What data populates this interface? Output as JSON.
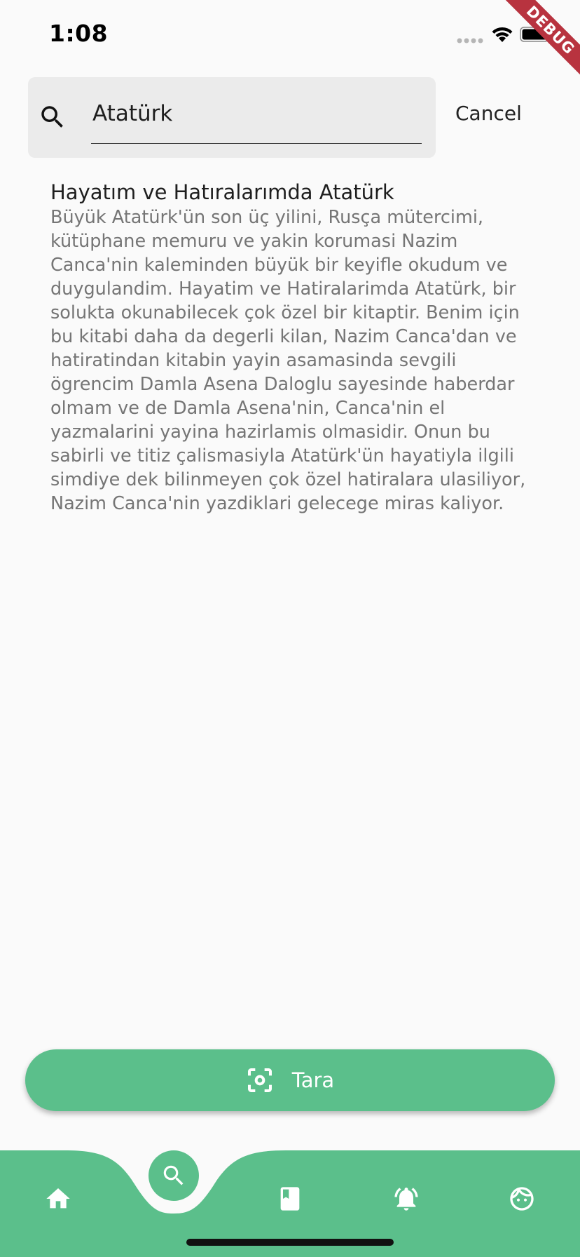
{
  "status_bar": {
    "time": "1:08"
  },
  "debug_banner": {
    "label": "DEBUG"
  },
  "search": {
    "value": "Atatürk",
    "cancel_label": "Cancel"
  },
  "results": [
    {
      "title": "Hayatım ve Hatıralarımda Atatürk",
      "description": "Büyük Atatürk'ün son üç yilini, Rusça mütercimi, kütüphane memuru ve yakin korumasi Nazim Canca'nin kaleminden büyük bir keyifle okudum ve duygulandim. Hayatim ve Hatiralarimda Atatürk, bir solukta okunabilecek çok özel bir kitaptir. Benim için bu kitabi daha da degerli kilan, Nazim Canca'dan ve hatiratindan kitabin yayin asamasinda sevgili ögrencim Damla Asena Daloglu sayesinde haberdar olmam ve de Damla Asena'nin, Canca'nin el yazmalarini yayina hazirlamis olmasidir. Onun bu sabirli ve titiz çalismasiyla Atatürk'ün hayatiyla ilgili simdiye dek bilinmeyen çok özel hatiralara ulasiliyor, Nazim Canca'nin yazdiklari gelecege miras kaliyor."
    }
  ],
  "scan_button": {
    "label": "Tara",
    "icon": "scan-icon"
  },
  "bottom_nav": {
    "items": [
      {
        "icon": "home-icon"
      },
      {
        "icon": "search-icon",
        "active": true
      },
      {
        "icon": "book-icon"
      },
      {
        "icon": "bell-icon"
      },
      {
        "icon": "face-icon"
      }
    ]
  },
  "colors": {
    "accent": "#5bbf8b",
    "background": "#fafafa",
    "search_field": "#ebebeb",
    "debug": "#b8333f"
  }
}
